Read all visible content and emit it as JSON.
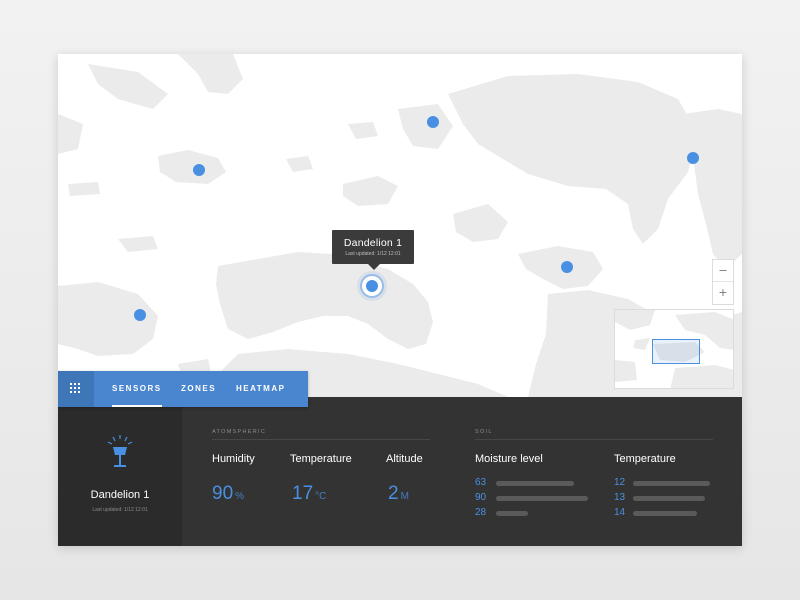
{
  "map": {
    "tooltip": {
      "title": "Dandelion 1",
      "subtitle": "Last updated: 1/12 12:01"
    },
    "zoom": {
      "out_label": "−",
      "in_label": "+"
    },
    "marker_color": "#4a90e2",
    "land_color": "#ebebeb"
  },
  "tabs": {
    "menu_icon": "grid-icon",
    "items": [
      {
        "label": "SENSORS",
        "active": true
      },
      {
        "label": "ZONES",
        "active": false
      },
      {
        "label": "HEATMAP",
        "active": false
      }
    ]
  },
  "device": {
    "icon": "lamp-icon",
    "name": "Dandelion 1",
    "last_updated": "Last updated: 1/12 12:01"
  },
  "atmospheric": {
    "label": "ATOMSPHERIC",
    "metrics": [
      {
        "label": "Humidity",
        "value": "90",
        "unit": "%"
      },
      {
        "label": "Temperature",
        "value": "17",
        "unit": "°C"
      },
      {
        "label": "Altitude",
        "value": "2",
        "unit": "M"
      }
    ]
  },
  "soil": {
    "label": "SOIL",
    "moisture": {
      "label": "Moisture level",
      "values": [
        "63",
        "90",
        "28"
      ]
    },
    "temperature": {
      "label": "Temperature",
      "values": [
        "12",
        "13",
        "14"
      ]
    }
  },
  "colors": {
    "accent": "#4a90e2",
    "tab_bar": "#4a86cf",
    "panel": "#333333",
    "panel_dark": "#2b2b2b"
  }
}
